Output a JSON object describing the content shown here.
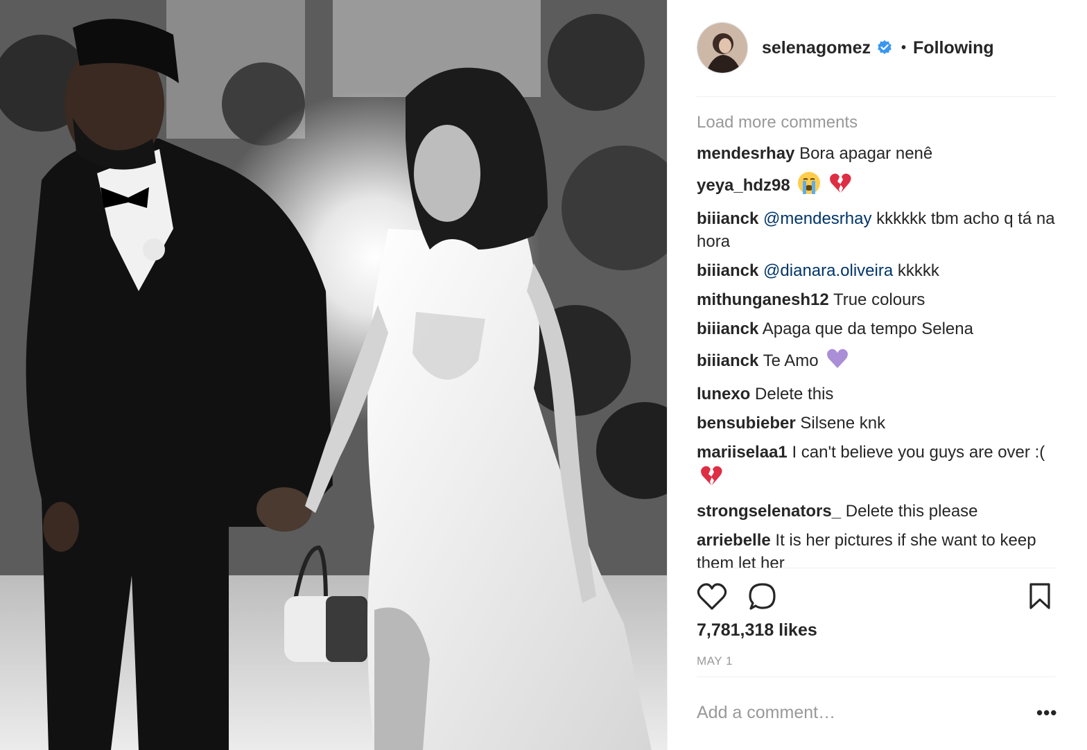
{
  "header": {
    "username": "selenagomez",
    "separator": "•",
    "follow_status": "Following"
  },
  "comments": {
    "load_more": "Load more comments",
    "items": [
      {
        "user": "mendesrhay",
        "text": "Bora apagar nenê"
      },
      {
        "user": "yeya_hdz98",
        "text": "",
        "emoji": [
          "crying-face-emoji",
          "broken-heart-emoji"
        ]
      },
      {
        "user": "biiianck",
        "mention": "@mendesrhay",
        "text": "kkkkkk tbm acho q tá na hora"
      },
      {
        "user": "biiianck",
        "mention": "@dianara.oliveira",
        "text": "kkkkk"
      },
      {
        "user": "mithunganesh12",
        "text": "True colours"
      },
      {
        "user": "biiianck",
        "text": "Apaga que da tempo Selena"
      },
      {
        "user": "biiianck",
        "text": "Te Amo",
        "emoji": [
          "purple-heart-emoji"
        ]
      },
      {
        "user": "lunexo",
        "text": "Delete this"
      },
      {
        "user": "bensubieber",
        "text": "Silsene knk"
      },
      {
        "user": "mariiselaa1",
        "text": "I can't believe you guys are over :(",
        "emoji": [
          "broken-heart-emoji"
        ]
      },
      {
        "user": "strongselenators_",
        "text": "Delete this please"
      },
      {
        "user": "arriebelle",
        "text": "It is her pictures if she want to keep them let her"
      }
    ]
  },
  "stats": {
    "likes": "7,781,318 likes",
    "date": "MAY 1"
  },
  "add_comment": {
    "placeholder": "Add a comment…",
    "more_label": "•••"
  },
  "icons": {
    "verified": "verified-badge-icon",
    "like": "heart-icon",
    "comment": "comment-bubble-icon",
    "save": "bookmark-icon",
    "more": "more-options-icon"
  },
  "colors": {
    "mention": "#003569",
    "muted": "#999999",
    "verified": "#3897f0",
    "text": "#262626"
  }
}
